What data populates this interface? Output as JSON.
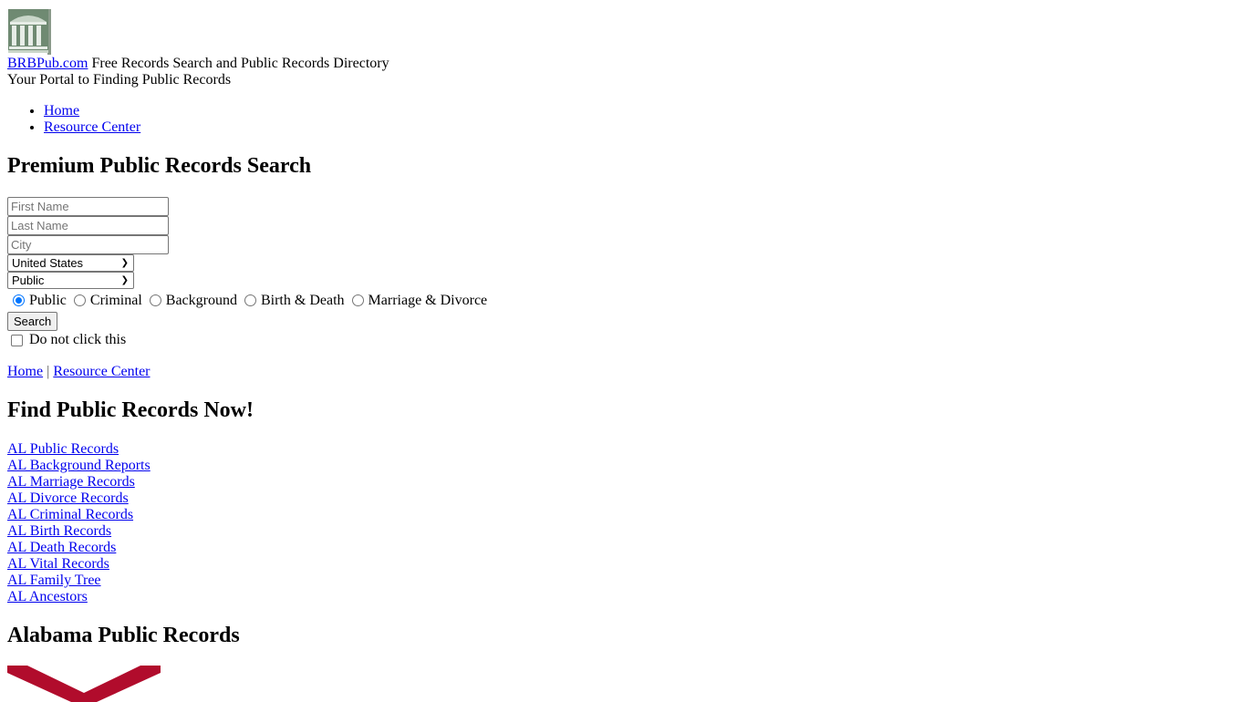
{
  "header": {
    "logo_icon": "courthouse-building-icon",
    "site_link": "BRBPub.com",
    "site_tagline": " Free Records Search and Public Records Directory",
    "subtitle": "Your Portal to Finding Public Records"
  },
  "nav": {
    "items": [
      {
        "label": "Home"
      },
      {
        "label": "Resource Center"
      }
    ]
  },
  "search": {
    "title": "Premium Public Records Search",
    "first_name_placeholder": "First Name",
    "last_name_placeholder": "Last Name",
    "city_placeholder": "City",
    "first_name_value": "",
    "last_name_value": "",
    "city_value": "",
    "country_selected": "United States",
    "type_selected": "Public",
    "radio_options": [
      {
        "label": "Public",
        "checked": true
      },
      {
        "label": "Criminal",
        "checked": false
      },
      {
        "label": "Background",
        "checked": false
      },
      {
        "label": "Birth & Death",
        "checked": false
      },
      {
        "label": "Marriage & Divorce",
        "checked": false
      }
    ],
    "submit_label": "Search",
    "checkbox_label": "Do not click this",
    "checkbox_checked": false
  },
  "breadcrumb": {
    "home": "Home",
    "separator": "|",
    "resource": "Resource Center"
  },
  "find_section": {
    "title": "Find Public Records Now!",
    "links": [
      "AL Public Records",
      "AL Background Reports",
      "AL Marriage Records",
      "AL Divorce Records",
      "AL Criminal Records",
      "AL Birth Records",
      "AL Death Records",
      "AL Vital Records",
      "AL Family Tree",
      "AL Ancestors"
    ]
  },
  "state_section": {
    "title": "Alabama Public Records",
    "flag_icon": "alabama-flag-icon",
    "flag_color": "#b10c2c"
  }
}
